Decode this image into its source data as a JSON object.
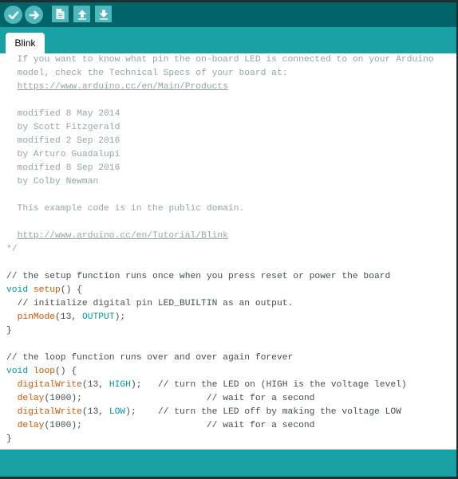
{
  "toolbar": {
    "buttons": [
      {
        "name": "verify",
        "icon": "checkmark-icon"
      },
      {
        "name": "upload",
        "icon": "arrow-right-icon"
      },
      {
        "name": "new",
        "icon": "new-file-icon"
      },
      {
        "name": "open",
        "icon": "arrow-up-icon"
      },
      {
        "name": "save",
        "icon": "arrow-down-icon"
      }
    ]
  },
  "tab": {
    "label": "Blink"
  },
  "code_lines": [
    {
      "kind": "comment",
      "text": "  If you want to know what pin the on-board LED is connected to on your Arduino"
    },
    {
      "kind": "comment",
      "text": "  model, check the Technical Specs of your board at:"
    },
    {
      "kind": "comment",
      "text": "  ",
      "link": "https://www.arduino.cc/en/Main/Products"
    },
    {
      "kind": "blank"
    },
    {
      "kind": "comment",
      "text": "  modified 8 May 2014"
    },
    {
      "kind": "comment",
      "text": "  by Scott Fitzgerald"
    },
    {
      "kind": "comment",
      "text": "  modified 2 Sep 2016"
    },
    {
      "kind": "comment",
      "text": "  by Arturo Guadalupi"
    },
    {
      "kind": "comment",
      "text": "  modified 8 Sep 2016"
    },
    {
      "kind": "comment",
      "text": "  by Colby Newman"
    },
    {
      "kind": "blank"
    },
    {
      "kind": "comment",
      "text": "  This example code is in the public domain."
    },
    {
      "kind": "blank"
    },
    {
      "kind": "comment",
      "text": "  ",
      "link": "http://www.arduino.cc/en/Tutorial/Blink"
    },
    {
      "kind": "comment",
      "text": "*/"
    },
    {
      "kind": "blank"
    },
    {
      "kind": "code",
      "segments": [
        {
          "t": "cm",
          "v": "// the setup function runs once when you press reset or power the board"
        }
      ]
    },
    {
      "kind": "code",
      "segments": [
        {
          "t": "kw",
          "v": "void"
        },
        {
          "t": "",
          "v": " "
        },
        {
          "t": "fn",
          "v": "setup"
        },
        {
          "t": "",
          "v": "() {"
        }
      ]
    },
    {
      "kind": "code",
      "segments": [
        {
          "t": "",
          "v": "  "
        },
        {
          "t": "cm",
          "v": "// initialize digital pin LED_BUILTIN as an output."
        }
      ]
    },
    {
      "kind": "code",
      "segments": [
        {
          "t": "",
          "v": "  "
        },
        {
          "t": "fn",
          "v": "pinMode"
        },
        {
          "t": "",
          "v": "(13, "
        },
        {
          "t": "k2",
          "v": "OUTPUT"
        },
        {
          "t": "",
          "v": ");"
        }
      ]
    },
    {
      "kind": "code",
      "segments": [
        {
          "t": "",
          "v": "}"
        }
      ]
    },
    {
      "kind": "blank"
    },
    {
      "kind": "code",
      "segments": [
        {
          "t": "cm",
          "v": "// the loop function runs over and over again forever"
        }
      ]
    },
    {
      "kind": "code",
      "segments": [
        {
          "t": "kw",
          "v": "void"
        },
        {
          "t": "",
          "v": " "
        },
        {
          "t": "fn",
          "v": "loop"
        },
        {
          "t": "",
          "v": "() {"
        }
      ]
    },
    {
      "kind": "code",
      "segments": [
        {
          "t": "",
          "v": "  "
        },
        {
          "t": "fn",
          "v": "digitalWrite"
        },
        {
          "t": "",
          "v": "(13, "
        },
        {
          "t": "k2",
          "v": "HIGH"
        },
        {
          "t": "",
          "v": ");   "
        },
        {
          "t": "cm",
          "v": "// turn the LED on (HIGH is the voltage level)"
        }
      ]
    },
    {
      "kind": "code",
      "segments": [
        {
          "t": "",
          "v": "  "
        },
        {
          "t": "fn",
          "v": "delay"
        },
        {
          "t": "",
          "v": "(1000);                       "
        },
        {
          "t": "cm",
          "v": "// wait for a second"
        }
      ]
    },
    {
      "kind": "code",
      "segments": [
        {
          "t": "",
          "v": "  "
        },
        {
          "t": "fn",
          "v": "digitalWrite"
        },
        {
          "t": "",
          "v": "(13, "
        },
        {
          "t": "k2",
          "v": "LOW"
        },
        {
          "t": "",
          "v": ");    "
        },
        {
          "t": "cm",
          "v": "// turn the LED off by making the voltage LOW"
        }
      ]
    },
    {
      "kind": "code",
      "segments": [
        {
          "t": "",
          "v": "  "
        },
        {
          "t": "fn",
          "v": "delay"
        },
        {
          "t": "",
          "v": "(1000);                       "
        },
        {
          "t": "cm",
          "v": "// wait for a second"
        }
      ]
    },
    {
      "kind": "code",
      "segments": [
        {
          "t": "",
          "v": "}"
        }
      ]
    }
  ],
  "colors": {
    "toolbar": "#006468",
    "tabstrip": "#17a1a5",
    "button": "#4db7bb",
    "comment": "#95a5a6",
    "keyword": "#00979c",
    "function": "#d35400",
    "text": "#434f54"
  }
}
